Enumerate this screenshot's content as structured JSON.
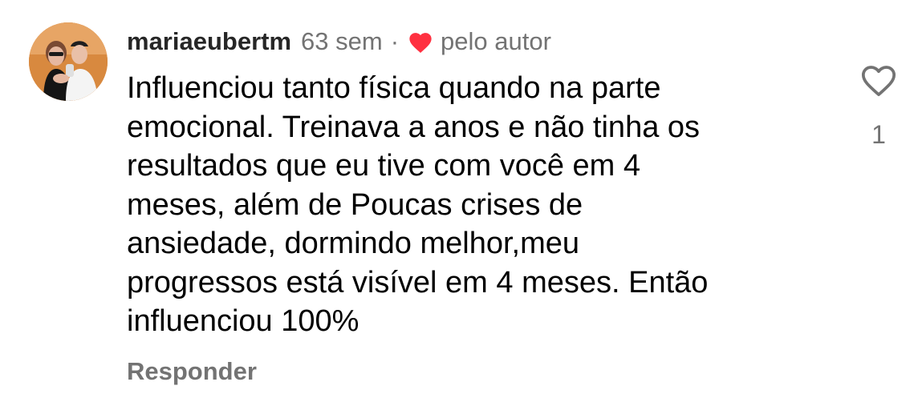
{
  "comment": {
    "username": "mariaeubertm",
    "time_ago": "63 sem",
    "separator": "·",
    "author_like_label": "pelo autor",
    "text": "Influenciou tanto física quando na parte\nemocional. Treinava a anos e não tinha os\nresultados que eu tive com você em 4\nmeses,  além de Poucas crises de\nansiedade, dormindo melhor,meu\nprogressos está visível em 4 meses. Então\ninfluenciou 100%",
    "reply_label": "Responder",
    "like_count": "1"
  },
  "icons": {
    "author_heart": "heart-filled-icon",
    "like": "heart-outline-icon"
  },
  "colors": {
    "username": "#262626",
    "secondary_text": "#737373",
    "body_text": "#000000",
    "heart_red": "#ff3040"
  }
}
